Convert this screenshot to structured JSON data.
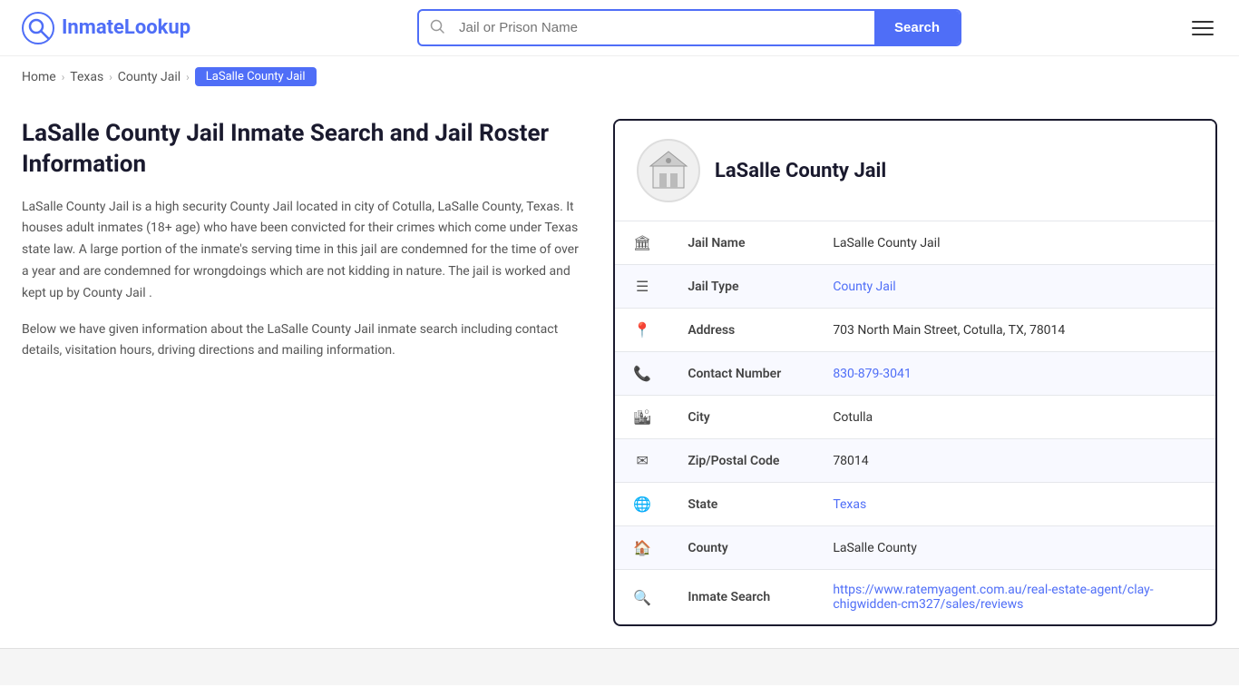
{
  "logo": {
    "text_part1": "Inmate",
    "text_part2": "Lookup"
  },
  "search": {
    "placeholder": "Jail or Prison Name",
    "button_label": "Search"
  },
  "breadcrumb": {
    "home": "Home",
    "texas": "Texas",
    "county_jail": "County Jail",
    "active": "LaSalle County Jail"
  },
  "left": {
    "title": "LaSalle County Jail Inmate Search and Jail Roster Information",
    "description1": "LaSalle County Jail is a high security County Jail located in city of Cotulla, LaSalle County, Texas. It houses adult inmates (18+ age) who have been convicted for their crimes which come under Texas state law. A large portion of the inmate's serving time in this jail are condemned for the time of over a year and are condemned for wrongdoings which are not kidding in nature. The jail is worked and kept up by County Jail .",
    "description2": "Below we have given information about the LaSalle County Jail inmate search including contact details, visitation hours, driving directions and mailing information."
  },
  "card": {
    "title": "LaSalle County Jail",
    "rows": [
      {
        "icon": "🏛",
        "label": "Jail Name",
        "value": "LaSalle County Jail",
        "link": null
      },
      {
        "icon": "☰",
        "label": "Jail Type",
        "value": "County Jail",
        "link": "#"
      },
      {
        "icon": "📍",
        "label": "Address",
        "value": "703 North Main Street, Cotulla, TX, 78014",
        "link": null
      },
      {
        "icon": "📞",
        "label": "Contact Number",
        "value": "830-879-3041",
        "link": "tel:830-879-3041"
      },
      {
        "icon": "🏙",
        "label": "City",
        "value": "Cotulla",
        "link": null
      },
      {
        "icon": "✉",
        "label": "Zip/Postal Code",
        "value": "78014",
        "link": null
      },
      {
        "icon": "🌐",
        "label": "State",
        "value": "Texas",
        "link": "#"
      },
      {
        "icon": "🏠",
        "label": "County",
        "value": "LaSalle County",
        "link": null
      },
      {
        "icon": "🔍",
        "label": "Inmate Search",
        "value": "https://www.ratemyagent.com.au/real-estate-agent/clay-chigwidden-cm327/sales/reviews",
        "link": "https://www.ratemyagent.com.au/real-estate-agent/clay-chigwidden-cm327/sales/reviews"
      }
    ]
  },
  "icons": {
    "jail": "🏛",
    "type": "≡",
    "address": "📍",
    "phone": "📞",
    "city": "🏙",
    "zip": "✉",
    "state": "🌐",
    "county": "🏠",
    "search": "🔍"
  }
}
